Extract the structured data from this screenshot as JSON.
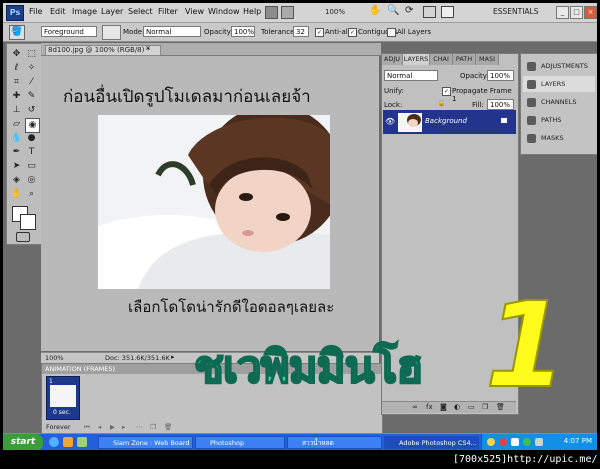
{
  "app": {
    "logo": "Ps",
    "workspace": "ESSENTIALS",
    "zoom": "100%"
  },
  "menu": [
    "File",
    "Edit",
    "Image",
    "Layer",
    "Select",
    "Filter",
    "View",
    "Window",
    "Help"
  ],
  "options_bar": {
    "preset": "Foreground",
    "mode_label": "Mode:",
    "mode_value": "Normal",
    "opacity_label": "Opacity:",
    "opacity_value": "100%",
    "tolerance_label": "Tolerance:",
    "tolerance_value": "32",
    "anti_alias": "Anti-alias",
    "contiguous": "Contiguous",
    "all_layers": "All Layers"
  },
  "document": {
    "tab_title": "8d100.jpg @ 100% (RGB/8) *",
    "status": "Doc: 351.6K/351.6K",
    "zoom": "100%",
    "text_top": "ก่อนอื่นเปิดรูปโมเดลมาก่อนเลยจ้า",
    "text_bottom": "เลือกโดโดน่ารักดีใอดอลๆเลยละ"
  },
  "animation": {
    "title": "ANIMATION (FRAMES)",
    "frame_time": "0 sec.",
    "loop": "Forever"
  },
  "layers_panel": {
    "tabs": [
      "ADJU",
      "LAYERS",
      "CHAI",
      "PATH",
      "MASI"
    ],
    "blend_mode": "Normal",
    "opacity_label": "Opacity:",
    "opacity_value": "100%",
    "unify_label": "Unify:",
    "propagate": "Propagate Frame 1",
    "lock_label": "Lock:",
    "fill_label": "Fill:",
    "fill_value": "100%",
    "layer_name": "Background"
  },
  "right_dock": [
    "ADJUSTMENTS",
    "LAYERS",
    "CHANNELS",
    "PATHS",
    "MASKS"
  ],
  "overlay": {
    "big_text": "ชเวพิมมินโฮ",
    "big_number": "1"
  },
  "taskbar": {
    "start": "start",
    "items": [
      "Siam Zone : Web Board :...",
      "Photoshop",
      "สาวน้ำหลด",
      "Adobe Photoshop CS4..."
    ],
    "clock": "4:07 PM"
  },
  "footer": "[700x525]http://upic.me/",
  "colors": {
    "big_text": "#2ff0b8",
    "big_number": "#fffb1a",
    "layer_selected": "#23348d",
    "taskbar": "#245edb"
  }
}
